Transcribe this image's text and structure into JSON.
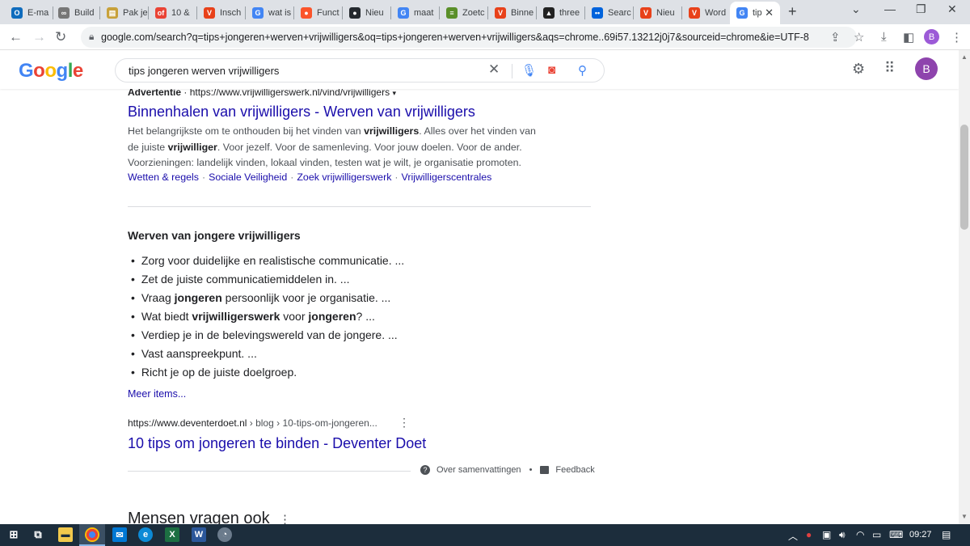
{
  "browser": {
    "tabs": [
      {
        "label": "E-ma",
        "icon": "outlook-icon",
        "color": "#0f6cbd",
        "glyph": "O"
      },
      {
        "label": "Build",
        "icon": "sketch-icon",
        "color": "#777777",
        "glyph": "∞"
      },
      {
        "label": "Pak je",
        "icon": "bookmark-icon",
        "color": "#c8a13a",
        "glyph": "▤"
      },
      {
        "label": "10 &",
        "icon": "of-icon",
        "color": "#ea4335",
        "glyph": "of"
      },
      {
        "label": "Insch",
        "icon": "v-logo-icon",
        "color": "#e8411a",
        "glyph": "V"
      },
      {
        "label": "wat is",
        "icon": "google-icon",
        "color": "#4285f4",
        "glyph": "G"
      },
      {
        "label": "Funct",
        "icon": "brave-icon",
        "color": "#fb542b",
        "glyph": "●"
      },
      {
        "label": "Nieu",
        "icon": "github-icon",
        "color": "#24292e",
        "glyph": "●"
      },
      {
        "label": "maat",
        "icon": "google-icon",
        "color": "#4285f4",
        "glyph": "G"
      },
      {
        "label": "Zoetc",
        "icon": "bank-icon",
        "color": "#5a8f29",
        "glyph": "≡"
      },
      {
        "label": "Binne",
        "icon": "v-logo-icon",
        "color": "#e8411a",
        "glyph": "V"
      },
      {
        "label": "three",
        "icon": "tree-icon",
        "color": "#222222",
        "glyph": "▲"
      },
      {
        "label": "Searc",
        "icon": "flickr-icon",
        "color": "#0063dc",
        "glyph": "••"
      },
      {
        "label": "Nieu",
        "icon": "v-logo-icon",
        "color": "#e8411a",
        "glyph": "V"
      },
      {
        "label": "Word",
        "icon": "v-logo-icon",
        "color": "#e8411a",
        "glyph": "V"
      },
      {
        "label": "tip",
        "icon": "google-icon",
        "color": "#4285f4",
        "glyph": "G",
        "active": true
      }
    ],
    "url": "google.com/search?q=tips+jongeren+werven+vrijwilligers&oq=tips+jongeren+werven+vrijwilligers&aqs=chrome..69i57.13212j0j7&sourceid=chrome&ie=UTF-8",
    "profile_initial": "B"
  },
  "google": {
    "logo": [
      {
        "ch": "G",
        "color": "#4285f4"
      },
      {
        "ch": "o",
        "color": "#ea4335"
      },
      {
        "ch": "o",
        "color": "#fbbc05"
      },
      {
        "ch": "g",
        "color": "#4285f4"
      },
      {
        "ch": "l",
        "color": "#34a853"
      },
      {
        "ch": "e",
        "color": "#ea4335"
      }
    ],
    "query": "tips jongeren werven vrijwilligers",
    "avatar_initial": "B"
  },
  "ad": {
    "label": "Advertentie",
    "sep": " · ",
    "url": "https://www.vrijwilligerswerk.nl/vind/vrijwilligers",
    "title": "Binnenhalen van vrijwilligers - Werven van vrijwilligers",
    "desc_html": "Het belangrijkste om te onthouden bij het vinden van <b>vrijwilligers</b>. Alles over het vinden van de juiste <b>vrijwilliger</b>. Voor jezelf. Voor de samenleving. Voor jouw doelen. Voor de ander. Voorzieningen: landelijk vinden, lokaal vinden, testen wat je wilt, je organisatie promoten.",
    "sitelinks": [
      "Wetten & regels",
      "Sociale Veiligheid",
      "Zoek vrijwilligerswerk",
      "Vrijwilligerscentrales"
    ]
  },
  "snippet": {
    "heading": "Werven van jongere vrijwilligers",
    "items": [
      "Zorg voor duidelijke en realistische communicatie. ...",
      "Zet de juiste communicatiemiddelen in. ...",
      "Vraag <b>jongeren</b> persoonlijk voor je organisatie. ...",
      "Wat biedt <b>vrijwilligerswerk</b> voor <b>jongeren</b>? ...",
      "Verdiep je in de belevingswereld van de jongere. ...",
      "Vast aanspreekpunt. ...",
      "Richt je op de juiste doelgroep."
    ],
    "more": "Meer items...",
    "source_url": "https://www.deventerdoet.nl",
    "source_path": " › blog › 10-tips-om-jongeren...",
    "source_title": "10 tips om jongeren te binden - Deventer Doet",
    "about": "Over samenvattingen",
    "dot": "•",
    "feedback": "Feedback"
  },
  "paa": {
    "heading": "Mensen vragen ook"
  },
  "taskbar": {
    "time": "09:27"
  }
}
